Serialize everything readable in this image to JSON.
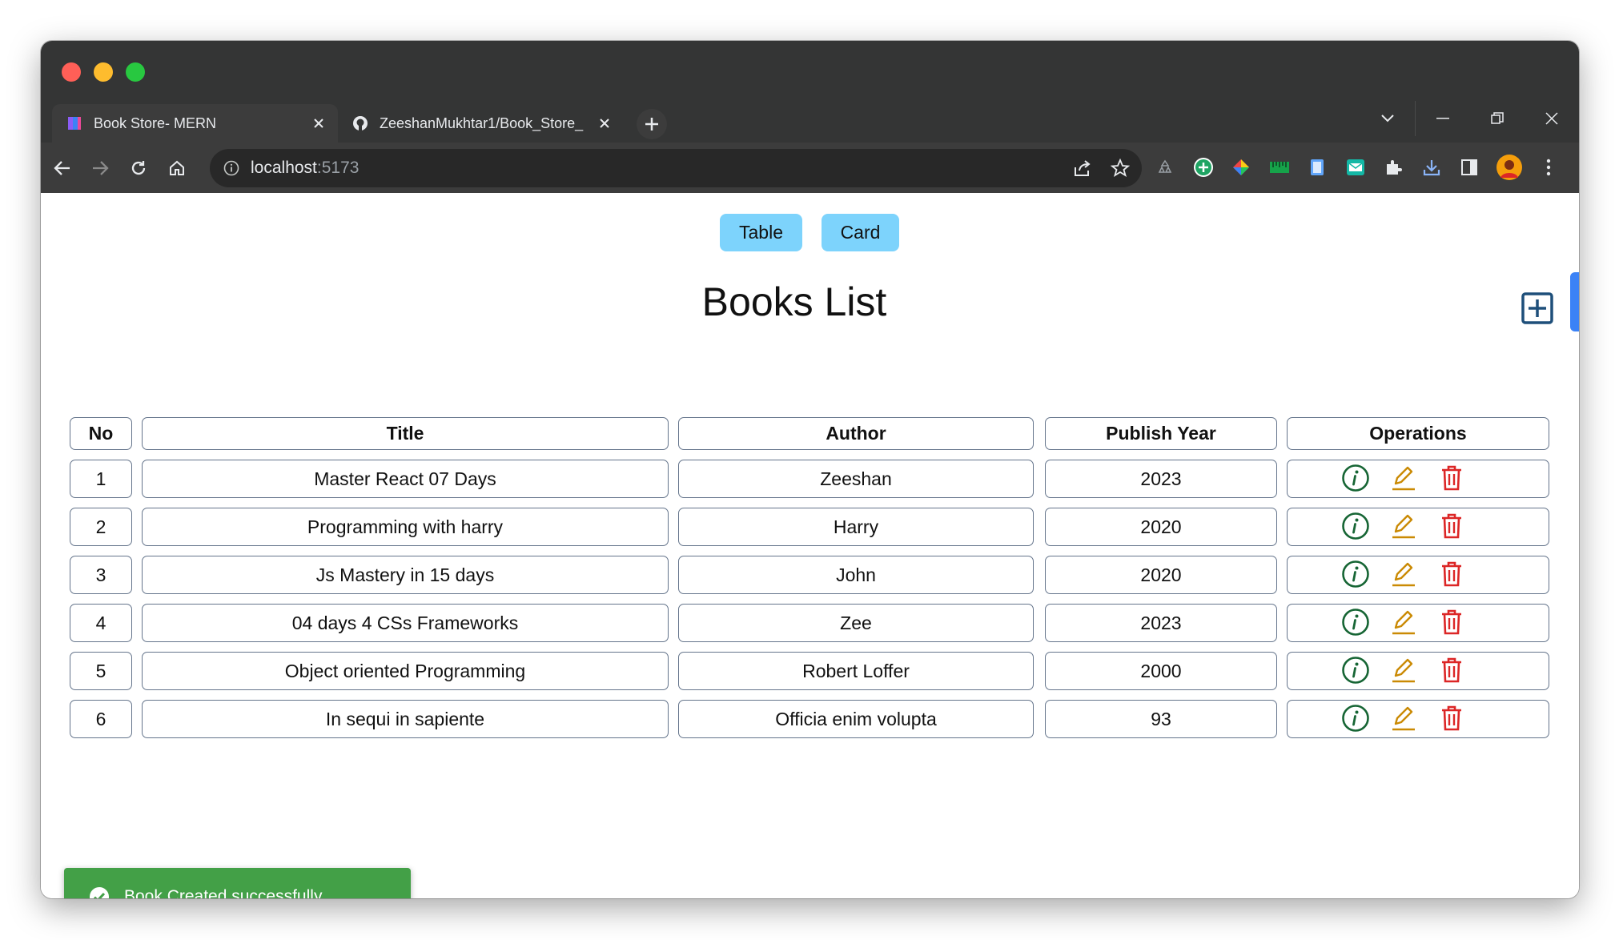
{
  "browser": {
    "tabs": [
      {
        "title": "Book Store- MERN",
        "active": true
      },
      {
        "title": "ZeeshanMukhtar1/Book_Store_",
        "active": false
      }
    ],
    "url_host": "localhost",
    "url_port": ":5173"
  },
  "page": {
    "view_toggle": {
      "table_label": "Table",
      "card_label": "Card"
    },
    "heading": "Books List",
    "table": {
      "columns": [
        "No",
        "Title",
        "Author",
        "Publish Year",
        "Operations"
      ],
      "rows": [
        {
          "no": "1",
          "title": "Master React 07 Days",
          "author": "Zeeshan",
          "year": "2023"
        },
        {
          "no": "2",
          "title": "Programming with harry",
          "author": "Harry",
          "year": "2020"
        },
        {
          "no": "3",
          "title": "Js Mastery in 15 days",
          "author": "John",
          "year": "2020"
        },
        {
          "no": "4",
          "title": "04 days 4 CSs Frameworks",
          "author": "Zee",
          "year": "2023"
        },
        {
          "no": "5",
          "title": "Object oriented Programming",
          "author": "Robert Loffer",
          "year": "2000"
        },
        {
          "no": "6",
          "title": "In sequi in sapiente",
          "author": "Officia enim volupta",
          "year": "93"
        }
      ],
      "operation_icons": [
        "info-icon",
        "edit-icon",
        "delete-icon"
      ]
    },
    "toast": {
      "message": "Book Created successfully"
    }
  },
  "colors": {
    "toggle_bg": "#7dd3fc",
    "add_icon": "#1e4f7a",
    "info_icon": "#166534",
    "edit_icon": "#ca8a04",
    "delete_icon": "#dc2626",
    "toast_bg": "#43a047",
    "scroll_accent": "#3b82f6"
  }
}
